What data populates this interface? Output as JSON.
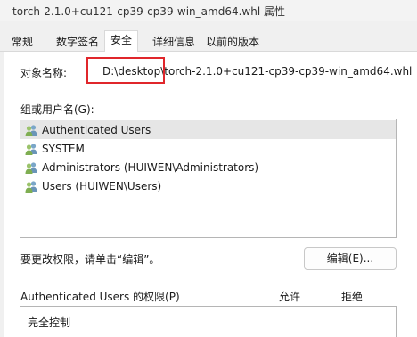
{
  "window": {
    "title": "torch-2.1.0+cu121-cp39-cp39-win_amd64.whl 属性"
  },
  "tabs": [
    {
      "label": "常规",
      "active": false
    },
    {
      "label": "数字签名",
      "active": false
    },
    {
      "label": "安全",
      "active": true
    },
    {
      "label": "详细信息",
      "active": false
    },
    {
      "label": "以前的版本",
      "active": false
    }
  ],
  "security": {
    "object_name_label": "对象名称:",
    "object_name_value": "D:\\desktop\\torch-2.1.0+cu121-cp39-cp39-win_amd64.whl",
    "group_label": "组或用户名(G):",
    "users": [
      {
        "label": "Authenticated Users",
        "icon": "users-group-icon",
        "selected": true
      },
      {
        "label": "SYSTEM",
        "icon": "users-group-icon",
        "selected": false
      },
      {
        "label": "Administrators (HUIWEN\\Administrators)",
        "icon": "users-group-icon",
        "selected": false
      },
      {
        "label": "Users (HUIWEN\\Users)",
        "icon": "users-group-icon",
        "selected": false
      }
    ],
    "change_permissions_text": "要更改权限，请单击“编辑”。",
    "edit_button": "编辑(E)...",
    "permissions_header": "Authenticated Users 的权限(P)",
    "allow_label": "允许",
    "deny_label": "拒绝",
    "permissions": [
      {
        "label": "完全控制"
      }
    ]
  },
  "colors": {
    "highlight_box": "#e0262b",
    "selected_row": "#e6e6e6"
  }
}
